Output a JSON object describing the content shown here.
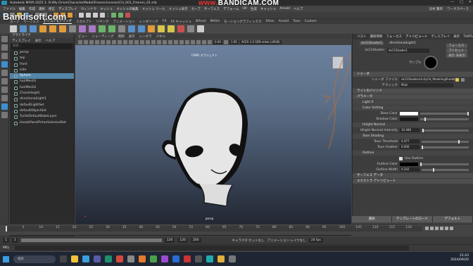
{
  "window": {
    "title": "Autodesk MAYA 2025.1: D:\\My Drive\\CharacterModel\\Freeren\\scenes\\CH_001_Freeren_01.mb",
    "controls": [
      "—",
      "□",
      "✕"
    ]
  },
  "bandicam": {
    "prefix": "www.",
    "brand": "BANDICAM",
    ".suffix": ".com"
  },
  "watermark": "Bandisoft.com",
  "menubar": {
    "items": [
      "ファイル",
      "編集",
      "作成",
      "選択",
      "修正",
      "ディスプレイ",
      "ウィンドウ",
      "メッシュ",
      "メッシュの編集",
      "メッシュ ツール",
      "メッシュ表示",
      "カーブ",
      "サーフェス",
      "デフォーム",
      "UV",
      "生成",
      "キャッシュ",
      "Arnold",
      "ヘルプ"
    ],
    "user": "比村 賢斉",
    "workspace": "ワークスペース"
  },
  "shelftabs": [
    "カーブ",
    "サーフェス",
    "ポリゴンモデリング",
    "スカルプト",
    "リギング",
    "アニメーション",
    "レンダリング",
    "FX",
    "FX キャッシュ",
    "Bifrost",
    "MASH",
    "モーショングラフィックス",
    "XGen",
    "Arnold",
    "Toon",
    "Custom"
  ],
  "outliner": {
    "title": "アウトライナ",
    "menu": [
      "ディスプレイ",
      "表示",
      "ヘルプ"
    ],
    "search": "検索...",
    "items": [
      {
        "label": "persp",
        "sel": false
      },
      {
        "label": "top",
        "sel": false
      },
      {
        "label": "front",
        "sel": false
      },
      {
        "label": "side",
        "sel": false
      },
      {
        "label": "Sphere",
        "sel": true
      },
      {
        "label": "hairMesh1",
        "sel": false
      },
      {
        "label": "hairMesh2",
        "sel": false
      },
      {
        "label": "CharaHeight",
        "sel": false
      },
      {
        "label": "directionalLight1",
        "sel": false
      },
      {
        "label": "defaultLightSet",
        "sel": false
      },
      {
        "label": "defaultObjectSet",
        "sel": false
      },
      {
        "label": "TurtleDefaultBakeLayer",
        "sel": false
      },
      {
        "label": "HeadsPanelPrimeSelectedSet",
        "sel": false
      }
    ]
  },
  "viewport": {
    "menu": [
      "ビュー",
      "シェーディング",
      "照明",
      "表示",
      "レンダラ",
      "パネル"
    ],
    "gamma": "ACES 1.0 SDR-video (sRGB)",
    "val1": "0.00",
    "val2": "1.00",
    "camera": "CAM1 オブジェクト",
    "footer": "persp",
    "axis": "+"
  },
  "attr": {
    "tabs": [
      "リスト",
      "選択項目",
      "フォーカス",
      "アトリビュート",
      "ディスプレイ",
      "表示",
      "TURTLE"
    ],
    "nodes": [
      "dx11Shader1",
      "directionalLight1"
    ],
    "shader_label": "dx11Shader:",
    "shader_value": "dx11Shader1",
    "focus": "フォーカス",
    "presets": "プリセット",
    "show": "表示 非表示",
    "sample": "サンプル",
    "sections": {
      "shader": "シェーダ",
      "file_label": "シェーダ ファイル",
      "file": "dx11ShadersUnityCH_ModelingShader.fx",
      "technique_label": "テクニック",
      "technique": "Main",
      "light_conn": "ライトのバインド",
      "params": "パラメータ",
      "light0": "Light 0",
      "color_setting": "Color Setting",
      "base": "Base Color",
      "shadow": "Shadow Color",
      "hilight": "Hilight Normal",
      "hilight_label": "Hilight Normal Intensity",
      "hilight_val": "10.480",
      "toon": "Toon Shading",
      "thr_label": "Toon Threshold",
      "thr_val": "0.477",
      "fea_label": "Toon Feather",
      "fea_val": "0.000",
      "outline": "Outline",
      "use": "Use Outline",
      "oc_label": "Outline Color",
      "ow_label": "Outline Width",
      "ow_val": "0.242",
      "surface": "サーフェス データ",
      "extra": "エクストラ アトリビュート"
    },
    "buttons": [
      "選択",
      "テンプレートのロード",
      "デフォルト"
    ]
  },
  "timeline": {
    "ticks": [
      "5",
      "10",
      "15",
      "20",
      "25",
      "30",
      "35",
      "40",
      "45",
      "50",
      "55",
      "60",
      "65",
      "70",
      "75",
      "80",
      "85",
      "90",
      "95",
      "100",
      "105",
      "110",
      "115",
      "120"
    ],
    "current": "1"
  },
  "range": {
    "start": "1",
    "start2": "1",
    "end": "120",
    "end2": "120",
    "end3": "200",
    "anim": "キャラクタ セットなし",
    "anim2": "アニメーション レイヤなし",
    "fps": "24 fps"
  },
  "cmdline": {
    "label": "MEL"
  },
  "taskbar": {
    "search": "検索",
    "time": "21:43",
    "date": "2024/09/20"
  },
  "colors": {
    "outline_sel": "#5285a6",
    "shadow_color": "#1a1a1a",
    "base_color": "#ffffff"
  }
}
